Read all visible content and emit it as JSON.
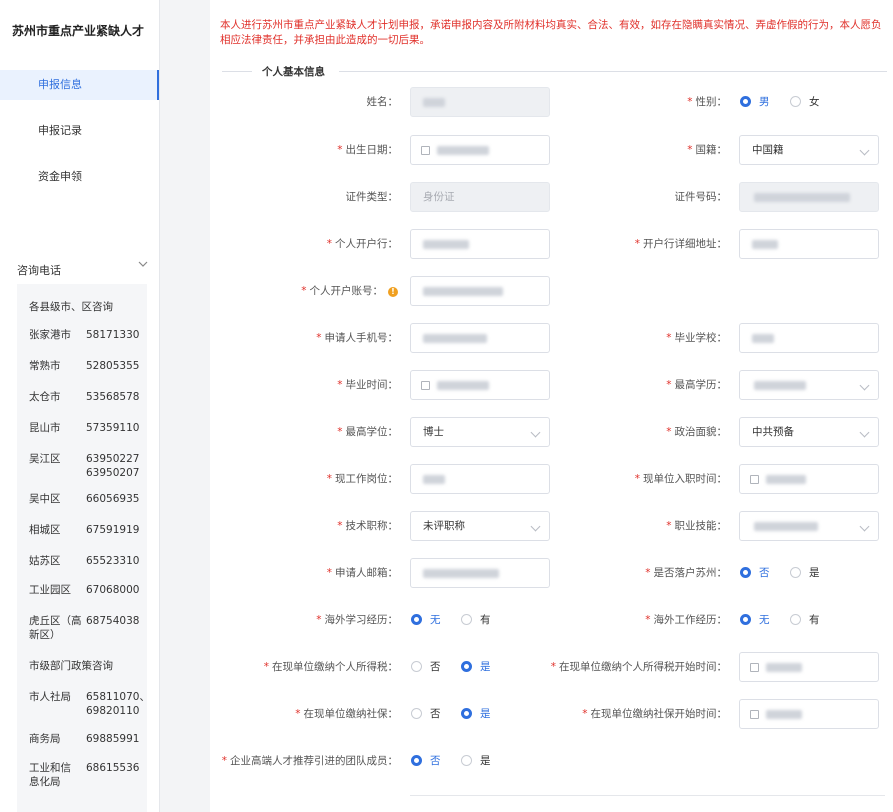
{
  "brand": "苏州市重点产业紧缺人才",
  "nav": [
    {
      "label": "申报信息",
      "active": true
    },
    {
      "label": "申报记录",
      "active": false
    },
    {
      "label": "资金申领",
      "active": false
    }
  ],
  "consult": {
    "title": "咨询电话",
    "chevron": "chevron-down-icon",
    "group_county": "各县级市、区咨询",
    "county": [
      {
        "name": "张家港市",
        "phone": "58171330"
      },
      {
        "name": "常熟市",
        "phone": "52805355"
      },
      {
        "name": "太仓市",
        "phone": "53568578"
      },
      {
        "name": "昆山市",
        "phone": "57359110"
      },
      {
        "name": "吴江区",
        "phone": "63950227\n63950207"
      },
      {
        "name": "吴中区",
        "phone": "66056935"
      },
      {
        "name": "相城区",
        "phone": "67591919"
      },
      {
        "name": "姑苏区",
        "phone": "65523310"
      },
      {
        "name": "工业园区",
        "phone": "67068000"
      },
      {
        "name": "虎丘区（高新区）",
        "phone": "68754038"
      }
    ],
    "group_city": "市级部门政策咨询",
    "city": [
      {
        "name": "市人社局",
        "phone": "65811070、69820110"
      },
      {
        "name": "商务局",
        "phone": "69885991"
      },
      {
        "name": "工业和信息化局",
        "phone": "68615536"
      }
    ]
  },
  "notice": "本人进行苏州市重点产业紧缺人才计划申报，承诺申报内容及所附材料均真实、合法、有效，如存在隐瞒真实情况、弄虚作假的行为，本人愿负相应法律责任，并承担由此造成的一切后果。",
  "section_title": "个人基本信息",
  "fields": {
    "name": {
      "label": "姓名："
    },
    "gender": {
      "label": "性别：",
      "options": [
        "男",
        "女"
      ],
      "selected": "男"
    },
    "birth": {
      "label": "出生日期："
    },
    "nationality": {
      "label": "国籍：",
      "value": "中国籍"
    },
    "id_type": {
      "label": "证件类型：",
      "placeholder": "身份证"
    },
    "id_number": {
      "label": "证件号码："
    },
    "bank": {
      "label": "个人开户行："
    },
    "bank_address": {
      "label": "开户行详细地址："
    },
    "account": {
      "label": "个人开户账号：",
      "icon": "warning-icon"
    },
    "phone": {
      "label": "申请人手机号："
    },
    "school": {
      "label": "毕业学校："
    },
    "grad_time": {
      "label": "毕业时间："
    },
    "education": {
      "label": "最高学历："
    },
    "degree": {
      "label": "最高学位：",
      "value": "博士"
    },
    "political": {
      "label": "政治面貌：",
      "value": "中共预备"
    },
    "position": {
      "label": "现工作岗位："
    },
    "entry_time": {
      "label": "现单位入职时间："
    },
    "title": {
      "label": "技术职称：",
      "value": "未评职称"
    },
    "skill": {
      "label": "职业技能："
    },
    "email": {
      "label": "申请人邮箱："
    },
    "hukou": {
      "label": "是否落户苏州：",
      "options": [
        "否",
        "是"
      ],
      "selected": "否"
    },
    "overseas_study": {
      "label": "海外学习经历：",
      "options": [
        "无",
        "有"
      ],
      "selected": "无"
    },
    "overseas_work": {
      "label": "海外工作经历：",
      "options": [
        "无",
        "有"
      ],
      "selected": "无"
    },
    "tax": {
      "label": "在现单位缴纳个人所得税：",
      "options": [
        "否",
        "是"
      ],
      "selected": "是"
    },
    "tax_start": {
      "label": "在现单位缴纳个人所得税开始时间："
    },
    "social": {
      "label": "在现单位缴纳社保：",
      "options": [
        "否",
        "是"
      ],
      "selected": "是"
    },
    "social_start": {
      "label": "在现单位缴纳社保开始时间："
    },
    "team": {
      "label": "企业高端人才推荐引进的团队成员：",
      "options": [
        "否",
        "是"
      ],
      "selected": "否"
    }
  },
  "colors": {
    "accent": "#2f6fde",
    "required": "#e0302a",
    "warning": "#f0a020"
  }
}
